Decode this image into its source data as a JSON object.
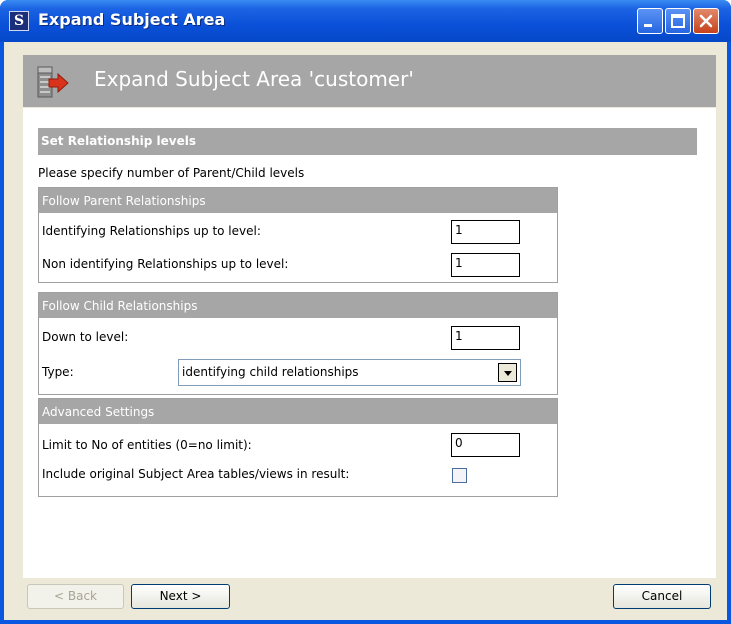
{
  "window": {
    "title": "Expand Subject Area",
    "app_icon_letter": "S",
    "controls": {
      "minimize": "minimize-icon",
      "maximize": "maximize-icon",
      "close": "close-icon"
    }
  },
  "banner": {
    "title": "Expand Subject Area 'customer'",
    "icon": "expand-subject-area-icon"
  },
  "section": {
    "title": "Set Relationship levels",
    "instruction": "Please specify number of Parent/Child levels"
  },
  "parent_group": {
    "header": "Follow Parent Relationships",
    "identifying_label": "Identifying Relationships up to level:",
    "identifying_value": "1",
    "non_identifying_label": "Non identifying Relationships up to level:",
    "non_identifying_value": "1"
  },
  "child_group": {
    "header": "Follow Child Relationships",
    "down_label": "Down to level:",
    "down_value": "1",
    "type_label": "Type:",
    "type_value": "identifying child relationships"
  },
  "advanced_group": {
    "header": "Advanced Settings",
    "limit_label": "Limit to No of entities (0=no limit):",
    "limit_value": "0",
    "include_label": "Include original Subject Area tables/views in result:",
    "include_checked": false
  },
  "buttons": {
    "back": "< Back",
    "next": "Next >",
    "cancel": "Cancel"
  },
  "colors": {
    "titlebar": "#0a50d8",
    "section_header": "#a6a6a6",
    "dialog_background": "#ece9d8"
  }
}
